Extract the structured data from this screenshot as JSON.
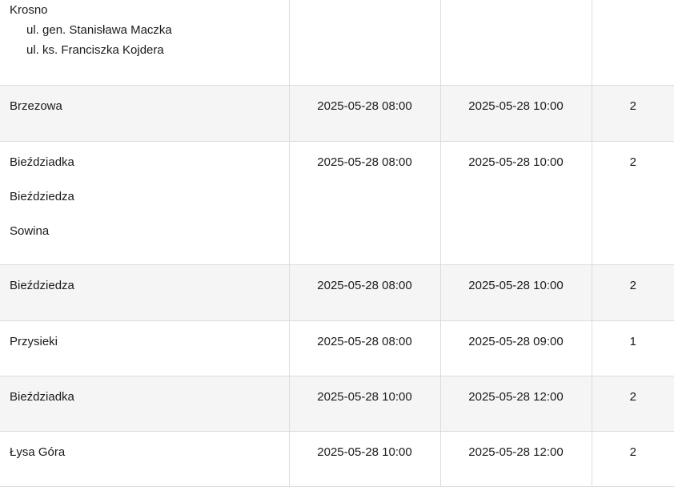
{
  "rows": [
    {
      "location_lines": [
        "Krosno"
      ],
      "sub_lines": [
        "ul. gen. Stanisława Maczka",
        "ul. ks. Franciszka Kojdera"
      ],
      "start": "",
      "end": "",
      "count": ""
    },
    {
      "location_lines": [
        "Brzezowa"
      ],
      "start": "2025-05-28 08:00",
      "end": "2025-05-28 10:00",
      "count": "2"
    },
    {
      "location_lines": [
        "Bieździadka",
        "Bieździedza",
        "Sowina"
      ],
      "start": "2025-05-28 08:00",
      "end": "2025-05-28 10:00",
      "count": "2"
    },
    {
      "location_lines": [
        "Bieździedza"
      ],
      "start": "2025-05-28 08:00",
      "end": "2025-05-28 10:00",
      "count": "2"
    },
    {
      "location_lines": [
        "Przysieki"
      ],
      "start": "2025-05-28 08:00",
      "end": "2025-05-28 09:00",
      "count": "1"
    },
    {
      "location_lines": [
        "Bieździadka"
      ],
      "start": "2025-05-28 10:00",
      "end": "2025-05-28 12:00",
      "count": "2"
    },
    {
      "location_lines": [
        "Łysa Góra"
      ],
      "start": "2025-05-28 10:00",
      "end": "2025-05-28 12:00",
      "count": "2"
    }
  ]
}
